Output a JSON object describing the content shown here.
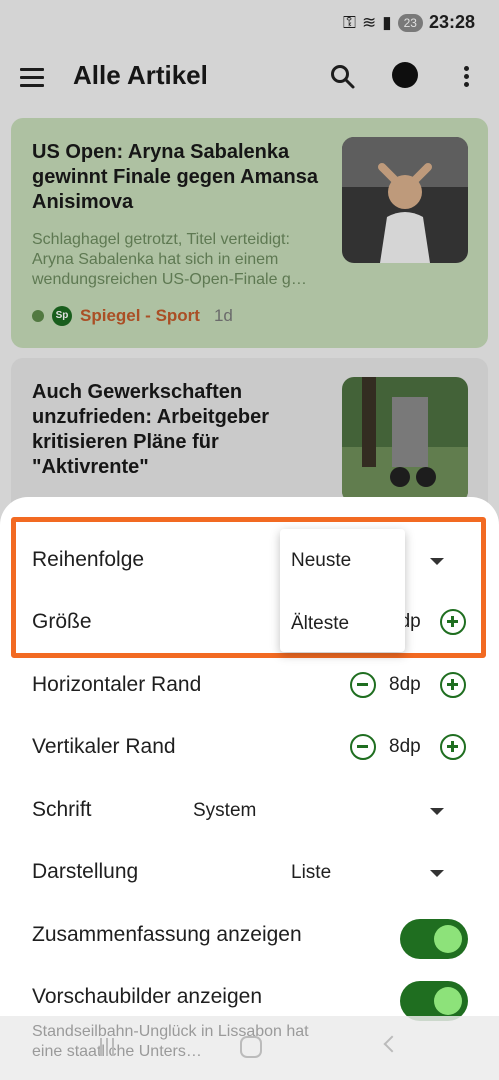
{
  "status_bar": {
    "battery_badge": "23",
    "time": "23:28"
  },
  "app_bar": {
    "title": "Alle Artikel"
  },
  "articles": [
    {
      "title": "US Open: Aryna Sabalenka gewinnt Finale gegen Amansa Anisimova",
      "summary": "Schlaghagel getrotzt, Titel verteidigt: Aryna Sabalenka hat sich in einem wendungsreichen US-Open-Finale g…",
      "source_logo": "Sp",
      "source": "Spiegel - Sport",
      "age": "1d"
    },
    {
      "title": "Auch Gewerkschaften unzufrieden: Arbeitgeber kritisieren Pläne für \"Aktivrente\""
    }
  ],
  "settings_sheet": {
    "order": {
      "label": "Reihenfolge"
    },
    "size": {
      "label": "Größe",
      "value": "8dp"
    },
    "horizontal_margin": {
      "label": "Horizontaler Rand",
      "value": "8dp"
    },
    "vertical_margin": {
      "label": "Vertikaler Rand",
      "value": "8dp"
    },
    "font": {
      "label": "Schrift",
      "value": "System"
    },
    "display": {
      "label": "Darstellung",
      "value": "Liste"
    },
    "show_summary": {
      "label": "Zusammenfassung anzeigen",
      "on": true
    },
    "show_thumbnails": {
      "label": "Vorschaubilder anzeigen",
      "on": true
    }
  },
  "order_dropdown": {
    "options": [
      "Neuste",
      "Älteste"
    ]
  },
  "background_peek": {
    "text": "Standseilbahn-Unglück in Lissabon hat eine staatliche Unters…"
  },
  "colors": {
    "accent": "#1f6e20",
    "toggle_knob": "#8de27a",
    "highlight": "#f26a22",
    "source": "#c25a2b"
  }
}
